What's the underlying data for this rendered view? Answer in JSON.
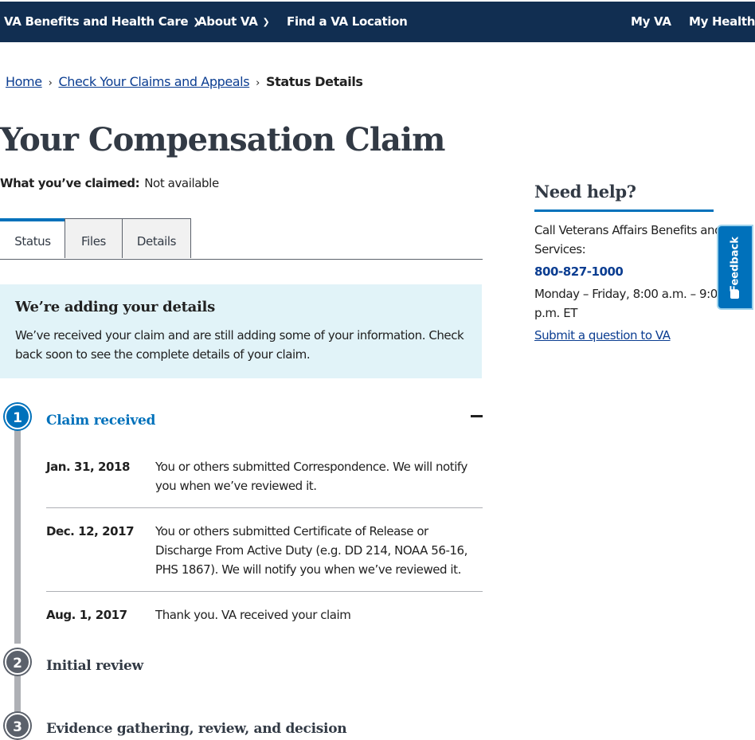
{
  "nav": {
    "items": [
      {
        "label": "VA Benefits and Health Care",
        "dropdown": true
      },
      {
        "label": "About VA",
        "dropdown": true
      },
      {
        "label": "Find a VA Location",
        "dropdown": false
      }
    ],
    "right": [
      "My VA",
      "My Health"
    ],
    "chevron_icon": "chevron-down-icon"
  },
  "breadcrumb": {
    "items": [
      "Home",
      "Check Your Claims and Appeals"
    ],
    "current": "Status Details"
  },
  "page": {
    "title": "Your Compensation Claim",
    "claimed_label": "What you’ve claimed:",
    "claimed_value": "Not available"
  },
  "tabs": [
    "Status",
    "Files",
    "Details"
  ],
  "alert": {
    "title": "We’re adding your details",
    "body": "We’ve received your claim and are still adding some of your information. Check back soon to see the complete details of your claim."
  },
  "timeline": {
    "steps": [
      {
        "number": "1",
        "title": "Claim received"
      },
      {
        "number": "2",
        "title": "Initial review"
      },
      {
        "number": "3",
        "title": "Evidence gathering, review, and decision"
      }
    ],
    "events": [
      {
        "date": "Jan. 31, 2018",
        "text": "You or others submitted Correspondence. We will notify you when we’ve reviewed it."
      },
      {
        "date": "Dec. 12, 2017",
        "text": "You or others submitted Certificate of Release or Discharge From Active Duty (e.g. DD 214, NOAA 56-16, PHS 1867). We will notify you when we’ve reviewed it."
      },
      {
        "date": "Aug. 1, 2017",
        "text": "Thank you. VA received your claim"
      }
    ]
  },
  "help": {
    "title": "Need help?",
    "intro": "Call Veterans Affairs Benefits and Services:",
    "phone": "800-827-1000",
    "hours": "Monday – Friday, 8:00 a.m. – 9:00 p.m. ET",
    "link": "Submit a question to VA"
  },
  "feedback": {
    "label": "Feedback"
  },
  "colors": {
    "nav": "#112e51",
    "primary": "#0071bb",
    "link": "#0b3d91",
    "alert_bg": "#e1f3f8"
  }
}
